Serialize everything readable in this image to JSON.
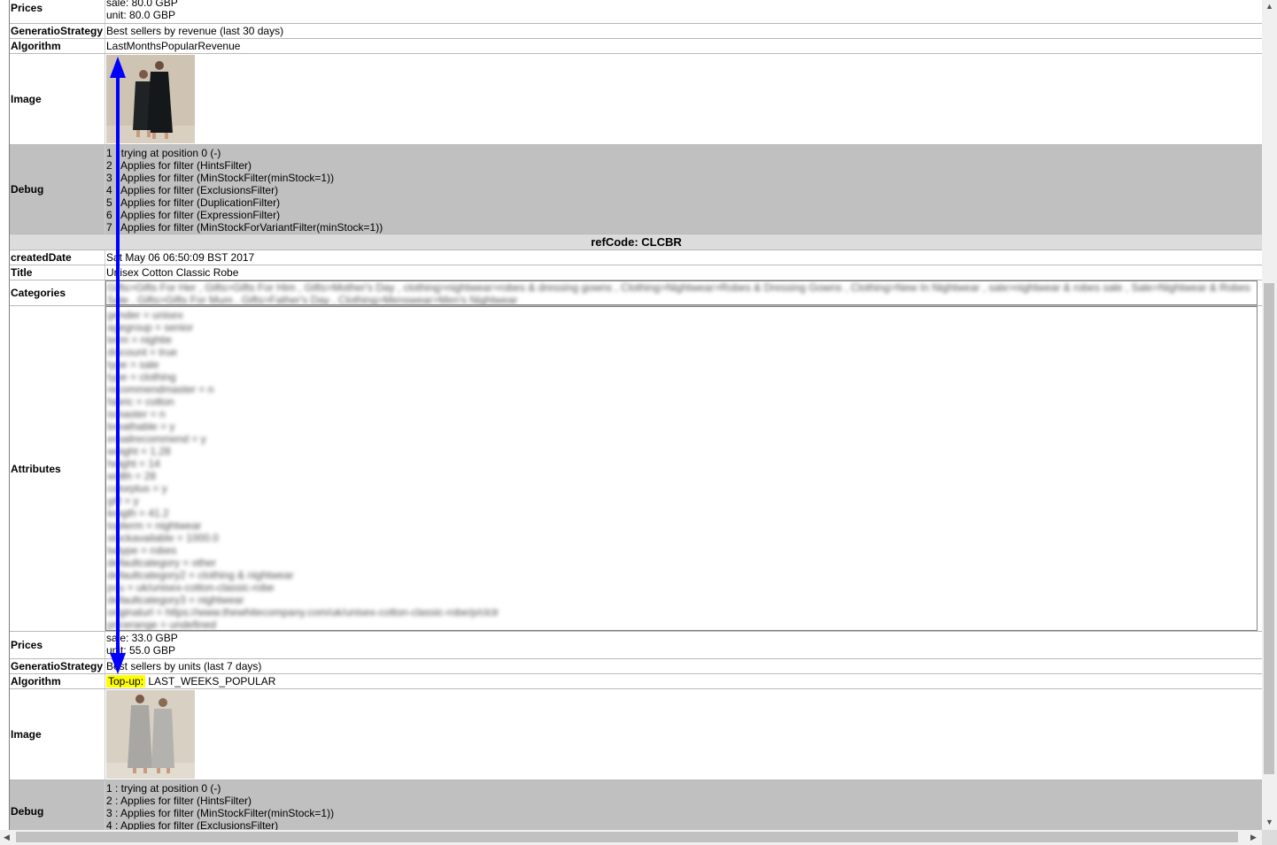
{
  "record1": {
    "prices_label": "Prices",
    "prices": [
      "sale: 80.0 GBP",
      "unit: 80.0 GBP"
    ],
    "strategy_label": "GeneratioStrategy",
    "strategy": "Best sellers by revenue (last 30 days)",
    "algorithm_label": "Algorithm",
    "algorithm": "LastMonthsPopularRevenue",
    "image_label": "Image",
    "debug_label": "Debug",
    "debug": [
      "1 : trying at position 0 (-)",
      "2 : Applies for filter (HintsFilter)",
      "3 : Applies for filter (MinStockFilter(minStock=1))",
      "4 : Applies for filter (ExclusionsFilter)",
      "5 : Applies for filter (DuplicationFilter)",
      "6 : Applies for filter (ExpressionFilter)",
      "7 : Applies for filter (MinStockForVariantFilter(minStock=1))"
    ]
  },
  "record2": {
    "refcode_header": "refCode: CLCBR",
    "created_label": "createdDate",
    "created": "Sat May 06 06:50:09 BST 2017",
    "title_label": "Title",
    "title": "Unisex Cotton Classic Robe",
    "categories_label": "Categories",
    "categories": [
      "Gifts>Gifts For Her , Gifts>Gifts For Him , Gifts>Mother's Day , clothing>nightwear>robes & dressing gowns , Clothing>Nightwear>Robes & Dressing Gowns , Clothing>New In Nightwear , sale>nightwear & robes sale , Sale>Nightwear & Robes",
      "Sale , Gifts>Gifts For Mum , Gifts>Father's Day , Clothing>Menswear>Men's Nightwear"
    ],
    "attributes_label": "Attributes",
    "attributes": [
      "gender = unisex",
      "agegroup = senior",
      "term = nightie",
      "discount = true",
      "type = sale",
      "type = clothing",
      "recommendmaster = n",
      "fabric = cotton",
      "ismaster = n",
      "breathable = y",
      "emailrecommend = y",
      "weight = 1.28",
      "height = 14",
      "width = 28",
      "colorplus = y",
      "gift = y",
      "length = 41.2",
      "topterm = nightwear",
      "stockavailable = 1000.0",
      "twtype = robes",
      "defaultcategory = other",
      "defaultcategory2 = clothing & nightwear",
      "pcu = uk/unisex-cotton-classic-robe",
      "defaultcategory3 = nightwear",
      "originalurl = https://www.thewhitecompany.com/uk/unisex-cotton-classic-robe/p/clclr",
      "pricerange = undefined"
    ],
    "prices_label": "Prices",
    "prices": [
      "sale: 33.0 GBP",
      "unit: 55.0 GBP"
    ],
    "strategy_label": "GeneratioStrategy",
    "strategy": "Best sellers by units (last 7 days)",
    "algorithm_label": "Algorithm",
    "algorithm_highlight": "Top-up:",
    "algorithm": "LAST_WEEKS_POPULAR",
    "image_label": "Image",
    "debug_label": "Debug",
    "debug": [
      "1 : trying at position 0 (-)",
      "2 : Applies for filter (HintsFilter)",
      "3 : Applies for filter (MinStockFilter(minStock=1))",
      "4 : Applies for filter (ExclusionsFilter)"
    ]
  },
  "colors": {
    "arrow": "#0000ff",
    "highlight": "#ffff00",
    "debug_bg": "#c0c0c0",
    "header_bg": "#dcdcdc"
  },
  "icons": {
    "arrow_up": "scroll-up-arrow-icon",
    "arrow_down": "scroll-down-arrow-icon",
    "arrow_left": "scroll-left-arrow-icon",
    "arrow_right": "scroll-right-arrow-icon"
  }
}
